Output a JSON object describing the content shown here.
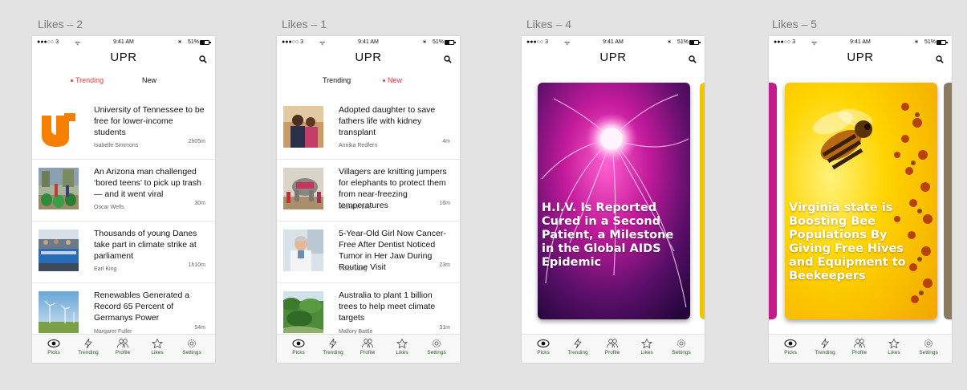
{
  "status_bar": {
    "carrier": "●●●○○ 3",
    "wifi": "ᯤ",
    "time": "9:41 AM",
    "bluetooth": "∗",
    "battery_pct": "51%"
  },
  "app_title": "UPR",
  "tabbar": [
    "Picks",
    "Trending",
    "Profile",
    "Likes",
    "Settings"
  ],
  "artboards": [
    {
      "label": "Likes – 2",
      "tabs": {
        "first": "Trending",
        "second": "New",
        "active": "first"
      },
      "items": [
        {
          "title": "University of Tennessee to be free for lower-income students",
          "author": "Isabelle Simmons",
          "time": "2h05m",
          "thumb": "ut-logo"
        },
        {
          "title": "An Arizona man challenged ‘bored teens’ to pick up trash — and it went viral",
          "author": "Oscar Wells",
          "time": "30m",
          "thumb": "trash-pickup"
        },
        {
          "title": "Thousands of young Danes take part in climate strike at parliament",
          "author": "Earl King",
          "time": "1h10m",
          "thumb": "climate-strike"
        },
        {
          "title": "Renewables Generated a Record 65 Percent of Germanys Power",
          "author": "Margaret Fuller",
          "time": "54m",
          "thumb": "wind-turbines"
        }
      ]
    },
    {
      "label": "Likes – 1",
      "tabs": {
        "first": "Trending",
        "second": "New",
        "active": "second"
      },
      "items": [
        {
          "title": "Adopted daughter to save fathers life with kidney transplant",
          "author": "Annika Redfern",
          "time": "4m",
          "thumb": "father-daughter"
        },
        {
          "title": "Villagers are knitting jumpers for elephants to protect them from near-freezing temperatures",
          "author": "Brandon Lee",
          "time": "16m",
          "thumb": "elephant"
        },
        {
          "title": "5-Year-Old Girl Now Cancer-Free After Dentist Noticed Tumor in Her Jaw During Routine Visit",
          "author": "Victor Lang",
          "time": "23m",
          "thumb": "dentist"
        },
        {
          "title": "Australia to plant 1 billion trees to help meet climate targets",
          "author": "Mallory Battle",
          "time": "31m",
          "thumb": "forest"
        }
      ]
    },
    {
      "label": "Likes – 4",
      "card_title": "H.I.V. Is Reported Cured in a Second Patient, a Milestone in the Global AIDS Epidemic",
      "card_image": "plasma-ball"
    },
    {
      "label": "Likes – 5",
      "card_title": "Virginia state is Boosting Bee Populations By Giving Free Hives and Equipment to Beekeepers",
      "card_image": "bee-flower"
    }
  ],
  "colors": {
    "background": "#e3e3e3",
    "accent_red": "#e23b3b",
    "tab_label_green": "#2c5a2a",
    "ut_orange": "#f77f00"
  }
}
